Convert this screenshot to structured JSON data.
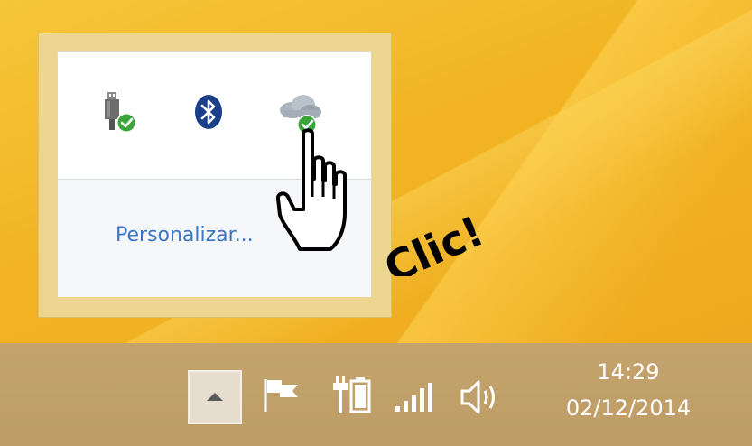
{
  "flyout": {
    "icons": [
      {
        "icon": "usb-safely-remove-icon",
        "status": "check-badge"
      },
      {
        "icon": "bluetooth-icon"
      },
      {
        "icon": "onedrive-cloud-icon",
        "status": "check-badge"
      }
    ],
    "personalize_link": "Personalizar..."
  },
  "annotation": {
    "text": "Clic!",
    "pointer": "hand-cursor-icon"
  },
  "taskbar": {
    "show_hidden_icon": "chevron-up-icon",
    "tray_icons": [
      "action-center-flag-icon",
      "battery-plug-icon",
      "signal-bars-icon",
      "speaker-volume-icon"
    ],
    "clock": {
      "time": "14:29",
      "date": "02/12/2014"
    }
  },
  "colors": {
    "desktop": "#f0b623",
    "taskbar": "#c4a46c",
    "link": "#3a76c4",
    "check_badge": "#3aa63a"
  }
}
